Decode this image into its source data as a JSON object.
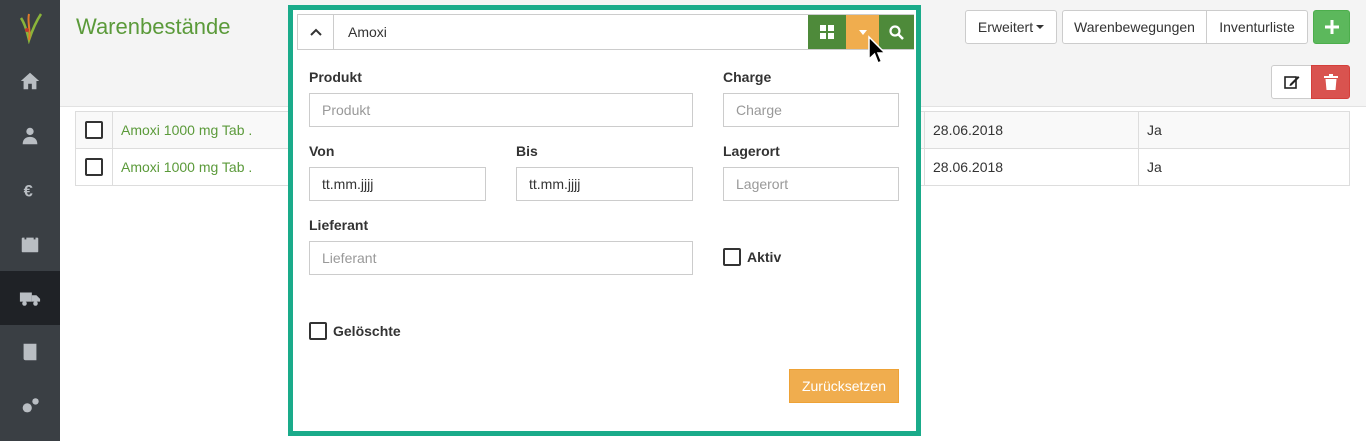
{
  "sidebar": {
    "items": [
      {
        "icon": "home-icon"
      },
      {
        "icon": "patients-icon"
      },
      {
        "icon": "euro-icon"
      },
      {
        "icon": "calendar-icon"
      },
      {
        "icon": "truck-icon",
        "active": true
      },
      {
        "icon": "book-icon"
      },
      {
        "icon": "settings-icon"
      }
    ]
  },
  "header": {
    "title": "Warenbestände",
    "erweitert_label": "Erweitert",
    "warenbewegungen_label": "Warenbewegungen",
    "inventurliste_label": "Inventurliste",
    "add_label": "+"
  },
  "table": {
    "rows": [
      {
        "product": "Amoxi 1000 mg Tab .",
        "date": "28.06.2018",
        "active": "Ja"
      },
      {
        "product": "Amoxi 1000 mg Tab .",
        "date": "28.06.2018",
        "active": "Ja"
      }
    ]
  },
  "filter": {
    "search_value": "Amoxi",
    "produkt_label": "Produkt",
    "produkt_placeholder": "Produkt",
    "charge_label": "Charge",
    "charge_placeholder": "Charge",
    "von_label": "Von",
    "von_placeholder": "tt.mm.jjjj",
    "bis_label": "Bis",
    "bis_placeholder": "tt.mm.jjjj",
    "lagerort_label": "Lagerort",
    "lagerort_placeholder": "Lagerort",
    "lieferant_label": "Lieferant",
    "lieferant_placeholder": "Lieferant",
    "aktiv_label": "Aktiv",
    "geloeschte_label": "Gelöschte",
    "reset_label": "Zurücksetzen"
  },
  "colors": {
    "accent_green": "#5b9a3a",
    "highlight": "#1aab8a",
    "warning": "#f0ad4e",
    "danger": "#d9534f"
  }
}
